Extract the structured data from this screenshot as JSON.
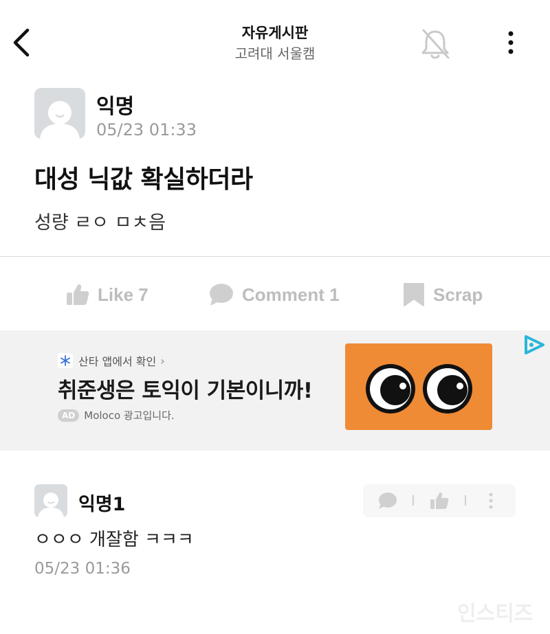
{
  "header": {
    "title": "자유게시판",
    "subtitle": "고려대 서울캠",
    "back_icon": "chevron-left-icon",
    "bell_icon": "bell-off-icon",
    "more_icon": "more-vertical-icon"
  },
  "post": {
    "author": "익명",
    "date": "05/23 01:33",
    "title": "대성 닉값 확실하더라",
    "body": "성량 ㄹㅇ ㅁㅊ음"
  },
  "actions": {
    "like": "Like 7",
    "comment": "Comment 1",
    "scrap": "Scrap"
  },
  "ad": {
    "source": "산타 앱에서 확인",
    "headline": "취준생은 토익이 기본이니까!",
    "badge": "AD",
    "advertiser": "Moloco 광고입니다."
  },
  "comments": [
    {
      "author": "익명1",
      "text": "ㅇㅇㅇ 개잘함 ㅋㅋㅋ",
      "date": "05/23 01:36"
    }
  ],
  "watermark": "인스티즈",
  "colors": {
    "ad_image": "#ef8a35",
    "ad_mark": "#29b6d8",
    "muted": "#bdbdbd"
  }
}
